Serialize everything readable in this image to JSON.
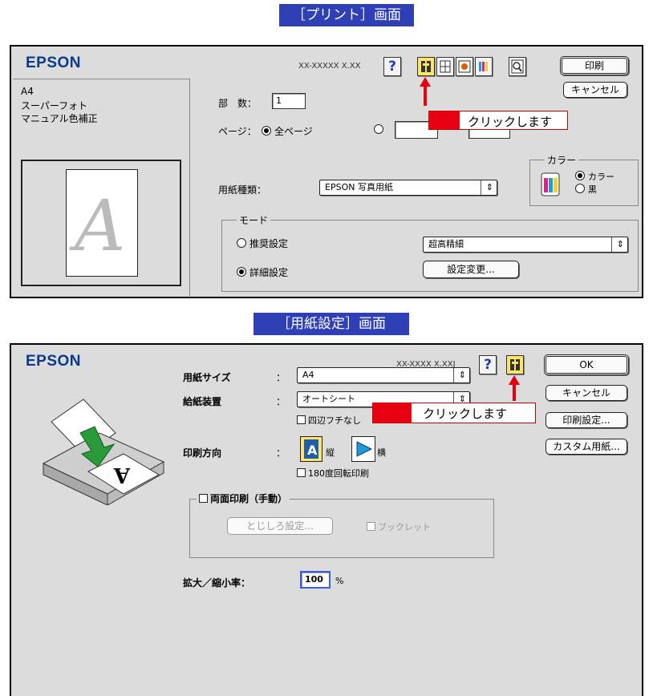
{
  "print_screen": {
    "heading": "［プリント］画面",
    "brand": "EPSON",
    "version": "XX-XXXXX X.XX",
    "help": "?",
    "print_button": "印刷",
    "cancel_button": "キャンセル",
    "summary": [
      "A4",
      "スーパーフォト",
      "マニュアル色補正"
    ],
    "preview_letter": "A",
    "copies_label": "部　数：",
    "copies_value": "1",
    "pages_label": "ページ：",
    "pages_all": "全ページ",
    "paper_type_label": "用紙種類：",
    "paper_type_value": "EPSON 写真用紙",
    "color_group": "カラー",
    "color_option": "カラー",
    "black_option": "黒",
    "mode_group": "モード",
    "mode_recommended": "推奨設定",
    "mode_advanced": "詳細設定",
    "quality_value": "超高精細",
    "settings_change_button": "設定変更...",
    "callout": "クリックします"
  },
  "page_setup_screen": {
    "heading": "［用紙設定］画面",
    "brand": "EPSON",
    "version": "XX-XXXX X.XXJ",
    "help": "?",
    "ok_button": "OK",
    "cancel_button": "キャンセル",
    "print_settings_button": "印刷設定...",
    "custom_paper_button": "カスタム用紙...",
    "paper_size_label": "用紙サイズ",
    "paper_size_value": "A4",
    "paper_source_label": "給紙装置",
    "paper_source_value": "オートシート",
    "borderless_label": "四辺フチなし",
    "orientation_label": "印刷方向",
    "portrait_label": "縦",
    "landscape_label": "横",
    "rotate_label": "180度回転印刷",
    "duplex_label": "両面印刷（手動）",
    "binding_button": "とじしろ設定...",
    "booklet_label": "ブックレット",
    "scale_label": "拡大／縮小率：",
    "scale_value": "100",
    "scale_unit": "%",
    "colon": "：",
    "callout": "クリックします",
    "printer_glyph": "A"
  },
  "colors": {
    "accent_red": "#e60012",
    "heading_blue": "#2f3fb6",
    "brand_blue": "#0a3a8c"
  }
}
